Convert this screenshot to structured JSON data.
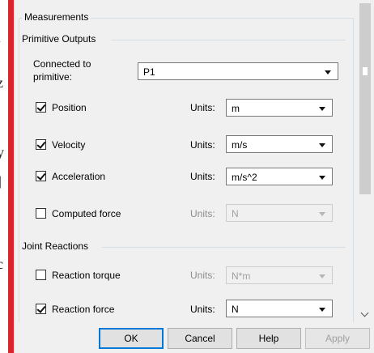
{
  "measurements": {
    "title": "Measurements"
  },
  "primitive_outputs": {
    "title": "Primitive Outputs",
    "connected_label_line1": "Connected to",
    "connected_label_line2": "primitive:",
    "connected_value": "P1",
    "units_label": "Units:",
    "rows": [
      {
        "label": "Position",
        "checked": true,
        "units": "m",
        "enabled": true
      },
      {
        "label": "Velocity",
        "checked": true,
        "units": "m/s",
        "enabled": true
      },
      {
        "label": "Acceleration",
        "checked": true,
        "units": "m/s^2",
        "enabled": true
      },
      {
        "label": "Computed force",
        "checked": false,
        "units": "N",
        "enabled": false
      }
    ]
  },
  "joint_reactions": {
    "title": "Joint Reactions",
    "rows": [
      {
        "label": "Reaction torque",
        "checked": false,
        "units": "N*m",
        "enabled": false
      },
      {
        "label": "Reaction force",
        "checked": true,
        "units": "N",
        "enabled": true
      }
    ]
  },
  "buttons": {
    "ok": "OK",
    "cancel": "Cancel",
    "help": "Help",
    "apply": "Apply"
  }
}
